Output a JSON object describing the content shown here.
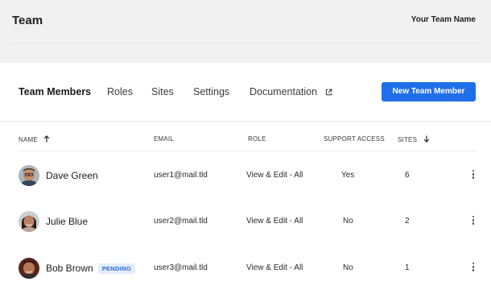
{
  "header": {
    "title": "Team",
    "team_name": "Your Team Name"
  },
  "tabs": [
    {
      "label": "Team Members",
      "active": true
    },
    {
      "label": "Roles"
    },
    {
      "label": "Sites"
    },
    {
      "label": "Settings"
    },
    {
      "label": "Documentation",
      "icon": "external-link-icon"
    }
  ],
  "new_member_button": "New Team Member",
  "table": {
    "columns": [
      {
        "label": "NAME",
        "sort": "ascending"
      },
      {
        "label": "EMAIL"
      },
      {
        "label": "ROLE"
      },
      {
        "label": "SUPPORT ACCESS"
      },
      {
        "label": "SITES",
        "sort": "descending"
      }
    ],
    "rows": [
      {
        "name": "Dave Green",
        "badge": "",
        "email": "user1@mail.tld",
        "role": "View & Edit - All",
        "support_access": "Yes",
        "sites": "6",
        "avatar": "avatar-dave"
      },
      {
        "name": "Julie Blue",
        "badge": "",
        "email": "user2@mail.tld",
        "role": "View & Edit - All",
        "support_access": "No",
        "sites": "2",
        "avatar": "avatar-julie"
      },
      {
        "name": "Bob Brown",
        "badge": "PENDING",
        "email": "user3@mail.tld",
        "role": "View & Edit - All",
        "support_access": "No",
        "sites": "1",
        "avatar": "avatar-bob"
      }
    ]
  },
  "colors": {
    "accent": "#1f6fe8",
    "header_bg": "#f1f1f1",
    "badge_bg": "#e3edfb",
    "badge_text": "#2a6ad8"
  }
}
